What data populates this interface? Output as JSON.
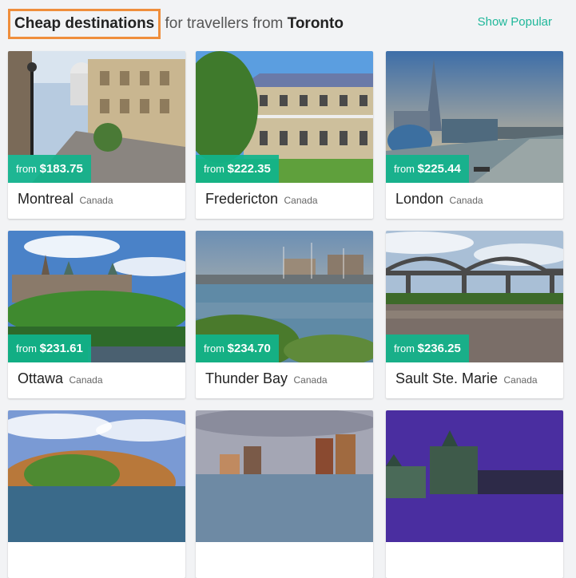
{
  "header": {
    "highlight": "Cheap destinations",
    "middle": " for travellers from ",
    "origin_city": "Toronto",
    "show_popular_label": "Show Popular"
  },
  "destinations": [
    {
      "city": "Montreal",
      "country": "Canada",
      "price_prefix": "from ",
      "price": "$183.75"
    },
    {
      "city": "Fredericton",
      "country": "Canada",
      "price_prefix": "from ",
      "price": "$222.35"
    },
    {
      "city": "London",
      "country": "Canada",
      "price_prefix": "from ",
      "price": "$225.44"
    },
    {
      "city": "Ottawa",
      "country": "Canada",
      "price_prefix": "from ",
      "price": "$231.61"
    },
    {
      "city": "Thunder Bay",
      "country": "Canada",
      "price_prefix": "from ",
      "price": "$234.70"
    },
    {
      "city": "Sault Ste. Marie",
      "country": "Canada",
      "price_prefix": "from ",
      "price": "$236.25"
    },
    {
      "city": "",
      "country": "",
      "price_prefix": "",
      "price": ""
    },
    {
      "city": "",
      "country": "",
      "price_prefix": "",
      "price": ""
    },
    {
      "city": "",
      "country": "",
      "price_prefix": "",
      "price": ""
    }
  ],
  "colors": {
    "accent": "#1fb79a",
    "price_badge": "#10b48c",
    "highlight_border": "#ef8e3c"
  }
}
